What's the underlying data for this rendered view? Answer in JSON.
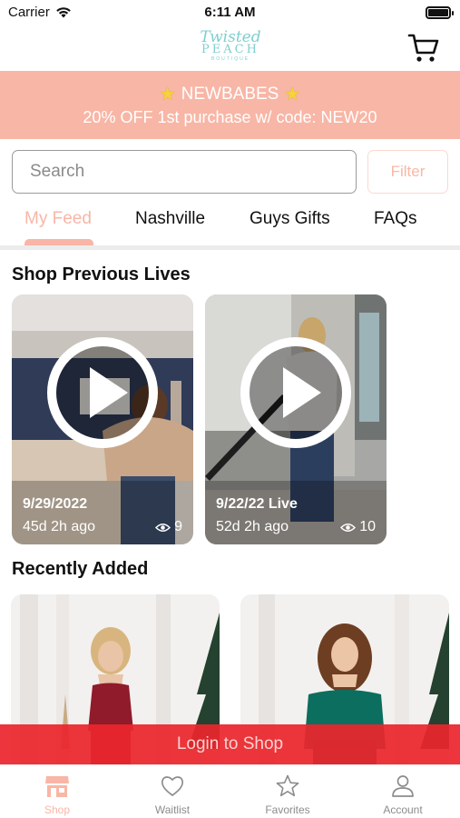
{
  "status_bar": {
    "carrier": "Carrier",
    "time": "6:11 AM"
  },
  "header": {
    "logo": {
      "script": "Twisted",
      "name": "PEACH",
      "sub": "BOUTIQUE"
    }
  },
  "promo": {
    "headline": "NEWBABES",
    "subline": "20% OFF 1st purchase w/ code: NEW20"
  },
  "search": {
    "placeholder": "Search",
    "filter_label": "Filter"
  },
  "tabs": [
    {
      "label": "My Feed",
      "active": true
    },
    {
      "label": "Nashville",
      "active": false
    },
    {
      "label": "Guys Gifts",
      "active": false
    },
    {
      "label": "FAQs",
      "active": false
    }
  ],
  "previous_lives": {
    "title": "Shop Previous Lives",
    "items": [
      {
        "date": "9/29/2022",
        "ago": "45d 2h ago",
        "views": "9"
      },
      {
        "date": "9/22/22 Live",
        "ago": "52d 2h ago",
        "views": "10"
      }
    ]
  },
  "recently_added": {
    "title": "Recently Added"
  },
  "login_bar": {
    "label": "Login to Shop"
  },
  "bottom_nav": [
    {
      "label": "Shop",
      "icon": "storefront-icon",
      "active": true
    },
    {
      "label": "Waitlist",
      "icon": "heart-icon",
      "active": false
    },
    {
      "label": "Favorites",
      "icon": "star-icon",
      "active": false
    },
    {
      "label": "Account",
      "icon": "person-icon",
      "active": false
    }
  ],
  "colors": {
    "brand_peach": "#f8b6a6",
    "login_red": "#eb262d",
    "logo_teal": "#7fcfcf"
  }
}
